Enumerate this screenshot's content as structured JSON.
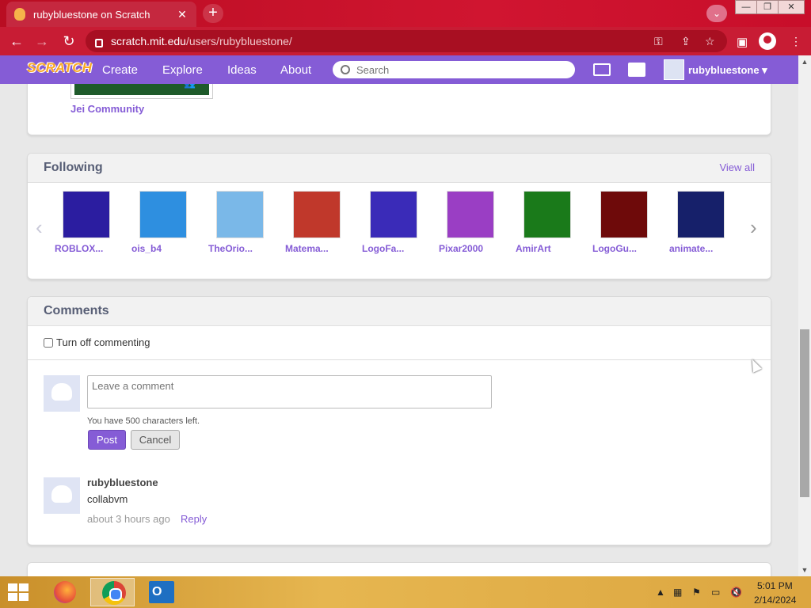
{
  "browser": {
    "tab_title": "rubybluestone on Scratch",
    "tab_close": "✕",
    "new_tab": "+",
    "url_host": "scratch.mit.edu",
    "url_path": "/users/rubybluestone/",
    "window_min": "—",
    "window_restore": "❐",
    "window_close": "✕",
    "back": "←",
    "forward": "→",
    "reload": "↻"
  },
  "nav": {
    "logo": "SCRATCH",
    "links": [
      "Create",
      "Explore",
      "Ideas",
      "About"
    ],
    "search_placeholder": "Search",
    "username": "rubybluestone ▾"
  },
  "studio": {
    "name": "Jei Community"
  },
  "following": {
    "title": "Following",
    "view_all": "View all",
    "prev_arrow": "‹",
    "next_arrow": "›",
    "users": [
      {
        "name": "ROBLOX...",
        "color": "#2b1da0"
      },
      {
        "name": "ois_b4",
        "color": "#2e8fe0"
      },
      {
        "name": "TheOrio...",
        "color": "#7ab8e8"
      },
      {
        "name": "Matema...",
        "color": "#c0382b"
      },
      {
        "name": "LogoFa...",
        "color": "#3a2bb8"
      },
      {
        "name": "Pixar2000",
        "color": "#9a3ec4"
      },
      {
        "name": "AmirArt",
        "color": "#1a7a1a"
      },
      {
        "name": "LogoGu...",
        "color": "#6e0a0a"
      },
      {
        "name": "animate...",
        "color": "#16206a"
      }
    ]
  },
  "comments": {
    "title": "Comments",
    "toggle_label": "Turn off commenting",
    "input_placeholder": "Leave a comment",
    "chars_left": "You have 500 characters left.",
    "post_label": "Post",
    "cancel_label": "Cancel",
    "items": [
      {
        "user": "rubybluestone",
        "text": "collabvm",
        "time": "about 3 hours ago",
        "reply": "Reply"
      }
    ]
  },
  "taskbar": {
    "time": "5:01 PM",
    "date": "2/14/2024",
    "outlook_letter": "O"
  },
  "colors": {
    "scratch_purple": "#855cd6",
    "browser_red": "#c81c34"
  }
}
